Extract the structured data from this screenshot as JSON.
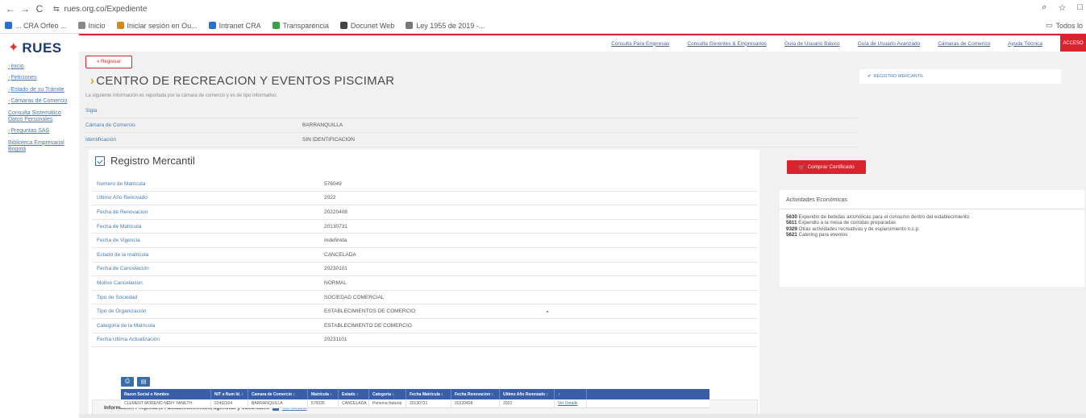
{
  "browser": {
    "back": "←",
    "forward": "→",
    "reload": "C",
    "url": "rues.org.co/Expediente",
    "zoom_icon": "⌕",
    "star_icon": "☆"
  },
  "bookmarks": {
    "items": [
      {
        "label": "... CRA Orfeo ...",
        "color": "#2b6fd1"
      },
      {
        "label": "Inicio",
        "color": "#888888"
      },
      {
        "label": "Iniciar sesión en Ou...",
        "color": "#d68a15"
      },
      {
        "label": "Intranet CRA",
        "color": "#2b6fd1"
      },
      {
        "label": "Transparencia",
        "color": "#37a04a"
      },
      {
        "label": "Docunet Web",
        "color": "#444444"
      },
      {
        "label": "Ley 1955 de 2019 -...",
        "color": "#777777"
      }
    ],
    "right_label": "Todos lo"
  },
  "sidebar": {
    "logo_text": "RUES",
    "items": [
      {
        "label": "Inicio"
      },
      {
        "label": "Peticiones"
      },
      {
        "label": "Estado de su Trámite"
      },
      {
        "label": "Cámaras de Comercio"
      },
      {
        "label": "Consulta Sistemático Datos Personales",
        "no_prefix": true
      },
      {
        "label": "Preguntas SAS"
      },
      {
        "label": "Biblioteca Empresarial Bogotá",
        "no_prefix": true
      }
    ]
  },
  "header": {
    "links": [
      "Consulta Para Empresas",
      "Consulta Gerentes & Empresarios",
      "Guía de Usuario Básico",
      "Guía de Usuario Avanzado",
      "Cámaras de Comercio",
      "Ayuda Técnica"
    ],
    "red_button": "ACCESO"
  },
  "main": {
    "back_label": "« Regresar",
    "title": "CENTRO DE RECREACION Y EVENTOS PISCIMAR",
    "notice": "La siguiente información es reportada por la cámara de comercio y es de tipo informativo.",
    "right_top": "REGISTRO MERCANTIL",
    "identity": [
      {
        "k": "Sigla",
        "v": ""
      },
      {
        "k": "Cámara de Comercio",
        "v": "BARRANQUILLA"
      },
      {
        "k": "Identificación",
        "v": "SIN IDENTIFICACION"
      }
    ]
  },
  "registro": {
    "title": "Registro Mercantil",
    "rows": [
      {
        "k": "Numero de Matricula",
        "v": "576049"
      },
      {
        "k": "Ultimo Año Renovado",
        "v": "2022"
      },
      {
        "k": "Fecha de Renovacion",
        "v": "20220408"
      },
      {
        "k": "Fecha de Matricula",
        "v": "20130731"
      },
      {
        "k": "Fecha de Vigencia",
        "v": "Indefinida"
      },
      {
        "k": "Estado de la matricula",
        "v": "CANCELADA"
      },
      {
        "k": "Fecha de Cancelación",
        "v": "20230101"
      },
      {
        "k": "Motivo Cancelacion",
        "v": "NORMAL"
      },
      {
        "k": "Tipo de Sociedad",
        "v": "SOCIEDAD COMERCIAL"
      },
      {
        "k": "Tipo de Organización",
        "v": "ESTABLECIMIENTOS DE COMERCIO"
      },
      {
        "k": "Categoria de la Matricula",
        "v": "ESTABLECIMIENTO DE COMERCIO"
      },
      {
        "k": "Fecha Ultima Actualización",
        "v": "20231101"
      }
    ],
    "owner_label": "Información Propietario / Establecimientos, agencias y sucursales",
    "owner_link": "Ver detalle"
  },
  "owners_table": {
    "headers": [
      "Razon Social o Nombre",
      "NIT o Num Id. ↕",
      "Camara de Comercio ↕",
      "Matricula ↕",
      "Estado ↕",
      "Categoria ↕",
      "Fecha Matricula ↕",
      "Fecha Renovacion ↕",
      "Ultimo Año Renovado ↕",
      "↕"
    ],
    "rows": [
      [
        "CLEMENT MORENO NERY YANETH",
        "22492104",
        "BARRANQUILLA",
        "575035",
        "CANCELADA",
        "Persona Natural",
        "20130731",
        "20220408",
        "2022",
        "Ver Detalle"
      ]
    ]
  },
  "right": {
    "cert_button": "Comprar Certificado",
    "activities_title": "Actividades Económicas",
    "activities": [
      {
        "code": "5630",
        "desc": "Expendio de bebidas alcohólicas para el consumo dentro del establecimiento"
      },
      {
        "code": "5611",
        "desc": "Expendio a la mesa de comidas preparadas"
      },
      {
        "code": "9329",
        "desc": "Otras actividades recreativas y de esparcimiento n.c.p."
      },
      {
        "code": "5621",
        "desc": "Catering para eventos"
      }
    ]
  }
}
